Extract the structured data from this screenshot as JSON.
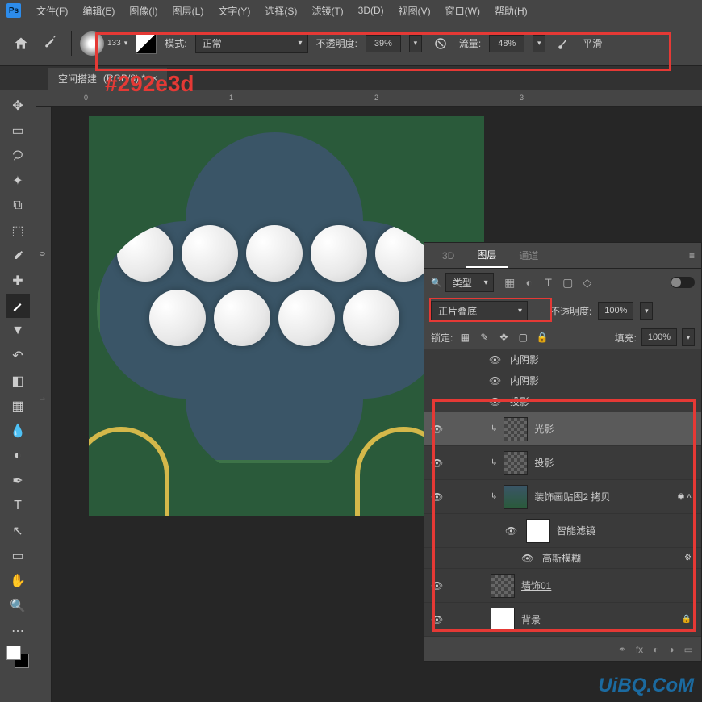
{
  "menubar": [
    "文件(F)",
    "编辑(E)",
    "图像(I)",
    "图层(L)",
    "文字(Y)",
    "选择(S)",
    "滤镜(T)",
    "3D(D)",
    "视图(V)",
    "窗口(W)",
    "帮助(H)"
  ],
  "optbar": {
    "brush_size": "133",
    "mode_label": "模式:",
    "mode_value": "正常",
    "opacity_label": "不透明度:",
    "opacity_value": "39%",
    "flow_label": "流量:",
    "flow_value": "48%",
    "smoothing_label": "平滑"
  },
  "annotation": "#292e3d",
  "tab": {
    "title": "空间搭建",
    "info": "(RGB/8) *"
  },
  "ruler_h": [
    "0",
    "1",
    "2",
    "3"
  ],
  "ruler_v": [
    "0",
    "1"
  ],
  "panel": {
    "tabs": [
      "3D",
      "图层",
      "通道"
    ],
    "type_label": "类型",
    "blend_mode": "正片叠底",
    "opacity_label": "不透明度:",
    "opacity_value": "100%",
    "lock_label": "锁定:",
    "fill_label": "填充:",
    "fill_value": "100%"
  },
  "layers": {
    "fx1": "内阴影",
    "fx2": "内阴影",
    "fx3": "投影",
    "l1": "光影",
    "l2": "投影",
    "l3": "装饰画贴图2 拷贝",
    "sf": "智能滤镜",
    "gb": "高斯模糊",
    "l4": "墙饰01",
    "l5": "背景"
  },
  "watermark": "UiBQ.CoM",
  "fx_label": "fx"
}
